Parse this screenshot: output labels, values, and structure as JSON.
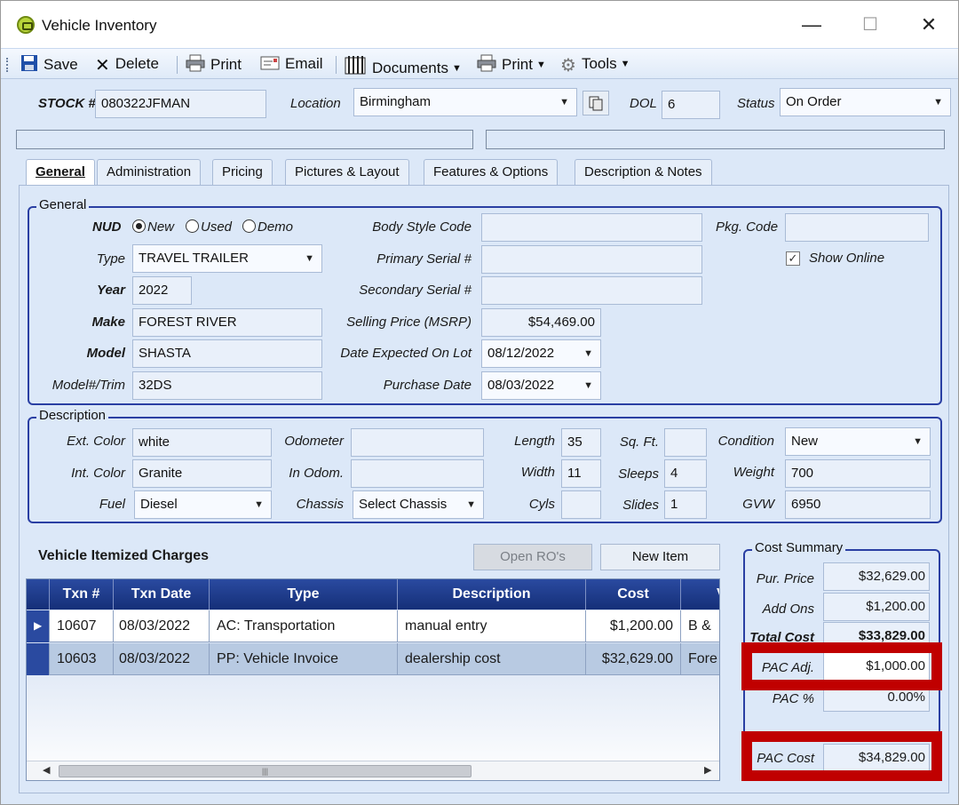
{
  "window": {
    "title": "Vehicle Inventory",
    "minimize": "—",
    "maximize": "☐",
    "close": "✕"
  },
  "toolbar": {
    "save": "Save",
    "delete": "Delete",
    "print1": "Print",
    "email": "Email",
    "documents": "Documents",
    "print2": "Print",
    "tools": "Tools"
  },
  "header": {
    "stock_label": "STOCK #",
    "stock_value": "080322JFMAN",
    "location_label": "Location",
    "location_value": "Birmingham",
    "dol_label": "DOL",
    "dol_value": "6",
    "status_label": "Status",
    "status_value": "On Order"
  },
  "tabs": [
    "General",
    "Administration",
    "Pricing",
    "Pictures & Layout",
    "Features & Options",
    "Description & Notes"
  ],
  "general": {
    "title": "General",
    "nud_label": "NUD",
    "nud_options": [
      "New",
      "Used",
      "Demo"
    ],
    "nud_selected": "New",
    "type_label": "Type",
    "type_value": "TRAVEL TRAILER",
    "year_label": "Year",
    "year_value": "2022",
    "make_label": "Make",
    "make_value": "FOREST RIVER",
    "model_label": "Model",
    "model_value": "SHASTA",
    "trim_label": "Model#/Trim",
    "trim_value": "32DS",
    "body_style_label": "Body Style Code",
    "body_style_value": "",
    "primary_serial_label": "Primary Serial #",
    "primary_serial_value": "",
    "secondary_serial_label": "Secondary Serial #",
    "secondary_serial_value": "",
    "msrp_label": "Selling Price (MSRP)",
    "msrp_value": "$54,469.00",
    "expected_label": "Date Expected On Lot",
    "expected_value": "08/12/2022",
    "purchase_label": "Purchase Date",
    "purchase_value": "08/03/2022",
    "pkg_label": "Pkg. Code",
    "pkg_value": "",
    "show_online_label": "Show Online",
    "show_online": true
  },
  "description": {
    "title": "Description",
    "ext_color_label": "Ext. Color",
    "ext_color_value": "white",
    "int_color_label": "Int. Color",
    "int_color_value": "Granite",
    "fuel_label": "Fuel",
    "fuel_value": "Diesel",
    "odometer_label": "Odometer",
    "odometer_value": "",
    "in_odom_label": "In Odom.",
    "in_odom_value": "",
    "chassis_label": "Chassis",
    "chassis_value": "Select Chassis",
    "length_label": "Length",
    "length_value": "35",
    "width_label": "Width",
    "width_value": "11",
    "cyls_label": "Cyls",
    "cyls_value": "",
    "sqft_label": "Sq. Ft.",
    "sqft_value": "",
    "sleeps_label": "Sleeps",
    "sleeps_value": "4",
    "slides_label": "Slides",
    "slides_value": "1",
    "condition_label": "Condition",
    "condition_value": "New",
    "weight_label": "Weight",
    "weight_value": "700",
    "gvw_label": "GVW",
    "gvw_value": "6950"
  },
  "charges": {
    "title": "Vehicle Itemized Charges",
    "open_ros": "Open RO's",
    "new_item": "New Item",
    "columns": [
      "Txn #",
      "Txn Date",
      "Type",
      "Description",
      "Cost",
      "V"
    ],
    "rows": [
      [
        "10607",
        "08/03/2022",
        "AC: Transportation",
        "manual entry",
        "$1,200.00",
        "B &"
      ],
      [
        "10603",
        "08/03/2022",
        "PP: Vehicle Invoice",
        "dealership cost",
        "$32,629.00",
        "Fore"
      ]
    ]
  },
  "cost_summary": {
    "title": "Cost Summary",
    "pur_price_label": "Pur. Price",
    "pur_price_value": "$32,629.00",
    "add_ons_label": "Add Ons",
    "add_ons_value": "$1,200.00",
    "total_cost_label": "Total Cost",
    "total_cost_value": "$33,829.00",
    "pac_adj_label": "PAC Adj.",
    "pac_adj_value": "$1,000.00",
    "pac_pct_label": "PAC %",
    "pac_pct_value": "0.00%",
    "pac_cost_label": "PAC Cost",
    "pac_cost_value": "$34,829.00"
  },
  "colors": {
    "group_border": "#2a3fa3",
    "highlight": "#c00000",
    "grid_header": "#1e3c8c"
  }
}
